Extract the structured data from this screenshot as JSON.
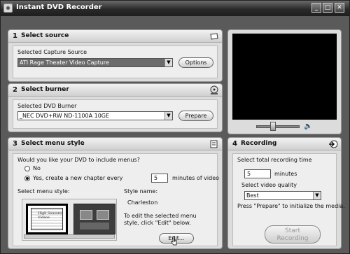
{
  "window": {
    "title": "Instant DVD Recorder",
    "controls": [
      "_",
      "□",
      "✕"
    ]
  },
  "source": {
    "num": "1",
    "title": "Select source",
    "capture_label": "Selected Capture Source",
    "capture_value": "ATI Rage Theater Video Capture",
    "options_label": "Options"
  },
  "burner": {
    "num": "2",
    "title": "Select burner",
    "dvd_label": "Selected DVD Burner",
    "dvd_value": "_NEC   DVD+RW ND-1100A 10GE",
    "prepare_label": "Prepare"
  },
  "menu": {
    "num": "3",
    "title": "Select menu style",
    "question": "Would you like your DVD to include menus?",
    "no_label": "No",
    "yes_label": "Yes, create a new chapter every",
    "minutes_value": "5",
    "minutes_label": "minutes of video",
    "style_label": "Select menu style:",
    "style_name_label": "Style name:",
    "style_name_value": "Charleston",
    "edit_hint": "To edit the selected menu style, click \"Edit\" below.",
    "edit_label": "Edit...",
    "thumb_text": "High Seasons Videos"
  },
  "recording": {
    "num": "4",
    "title": "Recording",
    "total_time_label": "Select total recording time",
    "time_value": "5",
    "minutes_label": "minutes",
    "quality_label": "Select video quality",
    "quality_value": "Best",
    "prepare_hint": "Press \"Prepare\" to initialize the media.",
    "start_label_1": "Start",
    "start_label_2": "Recording"
  }
}
